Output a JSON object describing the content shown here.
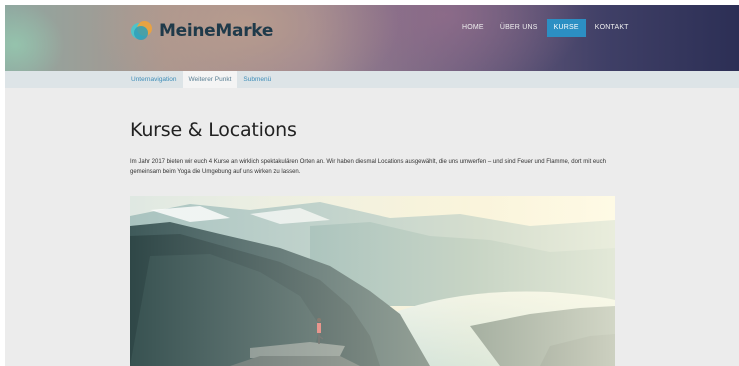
{
  "brand": {
    "name": "MeineMarke",
    "icon": "brand-logo-icon"
  },
  "nav": {
    "items": [
      {
        "label": "HOME",
        "active": false
      },
      {
        "label": "ÜBER UNS",
        "active": false
      },
      {
        "label": "KURSE",
        "active": true
      },
      {
        "label": "KONTAKT",
        "active": false
      }
    ]
  },
  "subnav": {
    "items": [
      {
        "label": "Unternavigation",
        "active": false
      },
      {
        "label": "Weiterer Punkt",
        "active": true
      },
      {
        "label": "Submenü",
        "active": false
      }
    ]
  },
  "page": {
    "title": "Kurse & Locations",
    "intro": "Im Jahr 2017 bieten wir euch 4 Kurse an wirklich spektakulären Orten an. Wir haben diesmal Locations ausgewählt, die uns umwerfen – und sind Feuer und Flamme, dort mit euch gemeinsam beim Yoga die Umgebung auf uns wirken zu lassen."
  },
  "colors": {
    "accent": "#2c8fc3",
    "link": "#3d8db8",
    "background": "#ececec"
  }
}
